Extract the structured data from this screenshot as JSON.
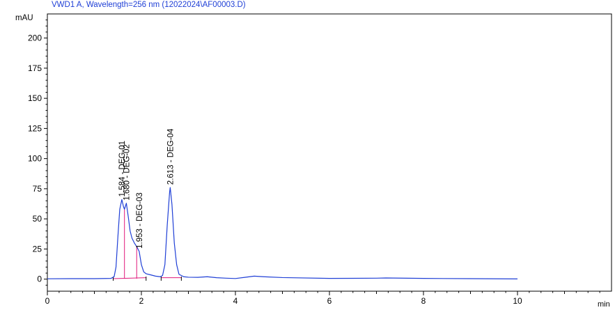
{
  "chart_data": {
    "type": "line",
    "title": "VWD1 A, Wavelength=256 nm (12022024\\AF00003.D)",
    "ylabel": "mAU",
    "xlabel": "min",
    "xlim": [
      0,
      12
    ],
    "ylim": [
      -10,
      220
    ],
    "x_ticks": [
      0,
      2,
      4,
      6,
      8,
      10
    ],
    "y_ticks": [
      0,
      25,
      50,
      75,
      100,
      125,
      150,
      175,
      200
    ],
    "line_color": "#1f3fd6",
    "integration_color": "#e0177a",
    "peaks": [
      {
        "rt": 1.584,
        "label": "1.584 - DEG-01",
        "height": 66
      },
      {
        "rt": 1.68,
        "label": "1.680 - DEG-02",
        "height": 63
      },
      {
        "rt": 1.953,
        "label": "1.953 - DEG-03",
        "height": 23
      },
      {
        "rt": 2.613,
        "label": "2.613 - DEG-04",
        "height": 76
      }
    ],
    "series": [
      {
        "x": [
          0.0,
          0.5,
          1.0,
          1.35,
          1.42,
          1.46,
          1.5,
          1.54,
          1.584,
          1.62,
          1.64,
          1.68,
          1.72,
          1.76,
          1.8,
          1.85,
          1.9,
          1.953,
          2.0,
          2.05,
          2.1,
          2.2,
          2.3,
          2.4,
          2.45,
          2.5,
          2.55,
          2.6,
          2.613,
          2.65,
          2.7,
          2.75,
          2.8,
          2.9,
          3.0,
          3.2,
          3.4,
          3.6,
          3.8,
          4.0,
          4.2,
          4.4,
          4.6,
          5.0,
          6.0,
          7.0,
          7.2,
          8.0,
          9.0,
          10.0
        ],
        "y": [
          0.3,
          0.4,
          0.4,
          0.6,
          2.0,
          10.0,
          35.0,
          58.0,
          66.0,
          60.0,
          58.0,
          63.0,
          52.0,
          40.0,
          34.0,
          30.0,
          27.0,
          23.0,
          12.0,
          6.0,
          4.5,
          3.5,
          2.5,
          2.0,
          3.0,
          12.0,
          45.0,
          72.0,
          76.0,
          62.0,
          30.0,
          12.0,
          4.0,
          2.0,
          1.6,
          1.5,
          2.0,
          1.2,
          0.8,
          0.5,
          1.5,
          2.5,
          2.0,
          1.3,
          0.6,
          0.8,
          1.0,
          0.6,
          0.4,
          0.2
        ]
      }
    ]
  }
}
